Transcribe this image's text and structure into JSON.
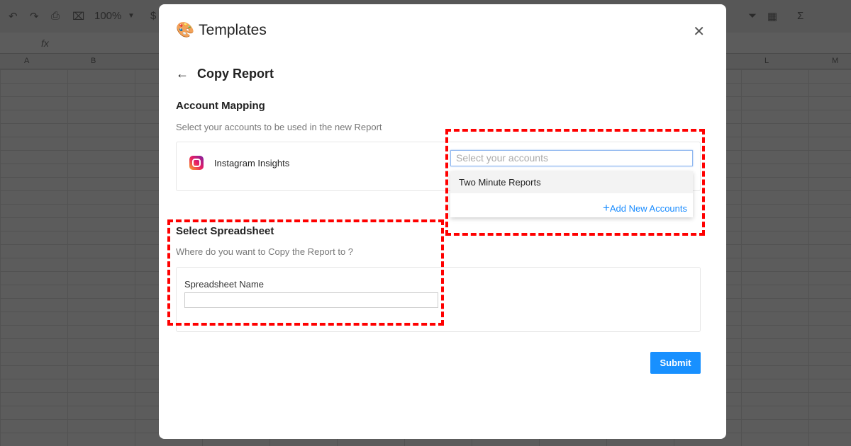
{
  "sheet": {
    "zoom": "100%",
    "currency": "$",
    "fx": "fx",
    "columns": [
      "A",
      "B",
      "L",
      "M"
    ]
  },
  "modal": {
    "title": "Templates",
    "page_title": "Copy Report",
    "account_mapping": {
      "heading": "Account Mapping",
      "subtitle": "Select your accounts to be used in the new Report",
      "source": "Instagram Insights",
      "select_placeholder": "Select your accounts",
      "options": [
        "Two Minute Reports"
      ],
      "add_label": "Add New Accounts"
    },
    "spreadsheet": {
      "heading": "Select Spreadsheet",
      "subtitle": "Where do you want to Copy the Report to ?",
      "field_label": "Spreadsheet Name",
      "field_value": ""
    },
    "submit_label": "Submit"
  },
  "colors": {
    "accent": "#1890ff",
    "highlight": "#ff0000"
  }
}
